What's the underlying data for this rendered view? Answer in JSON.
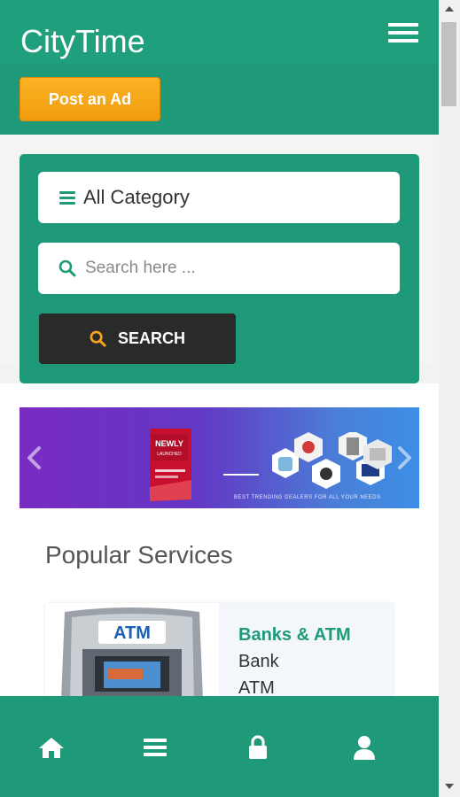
{
  "header": {
    "brand": "CityTime",
    "post_ad_label": "Post an Ad",
    "menu_icon": "hamburger-menu-icon"
  },
  "search": {
    "category_label": "All Category",
    "placeholder": "Search here ...",
    "button_label": "SEARCH"
  },
  "banner": {
    "promo_text_line1": "NEWLY",
    "promo_text_line2": "LAUNCHED",
    "tagline": "BEST TRENDING DEALERS FOR ALL YOUR NEEDS"
  },
  "popular": {
    "title": "Popular Services",
    "services": [
      {
        "name": "Banks & ATM",
        "items": [
          "Bank",
          "ATM"
        ],
        "image_label": "ATM"
      }
    ]
  },
  "bottom_nav": {
    "items": [
      {
        "icon": "home-icon"
      },
      {
        "icon": "list-icon"
      },
      {
        "icon": "lock-icon"
      },
      {
        "icon": "user-icon"
      }
    ]
  },
  "colors": {
    "primary": "#1e9a78",
    "accent": "#f5a616",
    "dark_button": "#2a2a2a"
  }
}
